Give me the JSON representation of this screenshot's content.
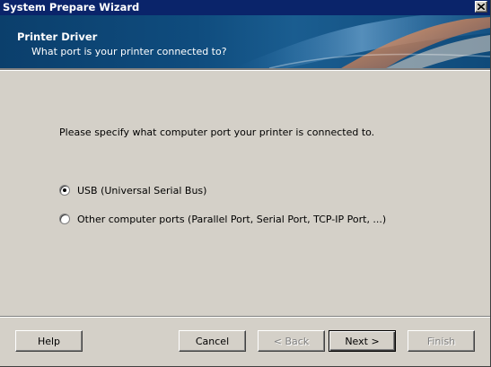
{
  "window": {
    "title": "System Prepare Wizard"
  },
  "banner": {
    "heading": "Printer Driver",
    "subheading": "What port is your printer connected to?"
  },
  "main": {
    "prompt": "Please specify what computer port your printer is connected to.",
    "options": [
      {
        "label": "USB (Universal Serial Bus)",
        "selected": true
      },
      {
        "label": "Other computer ports (Parallel Port, Serial Port, TCP-IP Port, ...)",
        "selected": false
      }
    ]
  },
  "footer": {
    "help_label": "Help",
    "cancel_label": "Cancel",
    "back_label": "< Back",
    "next_label": "Next >",
    "finish_label": "Finish",
    "back_enabled": false,
    "finish_enabled": false
  },
  "colors": {
    "titlebar": "#0a246a",
    "banner": "#0f4c7e",
    "face": "#d4d0c8"
  },
  "icons": {
    "close": "close-icon"
  }
}
